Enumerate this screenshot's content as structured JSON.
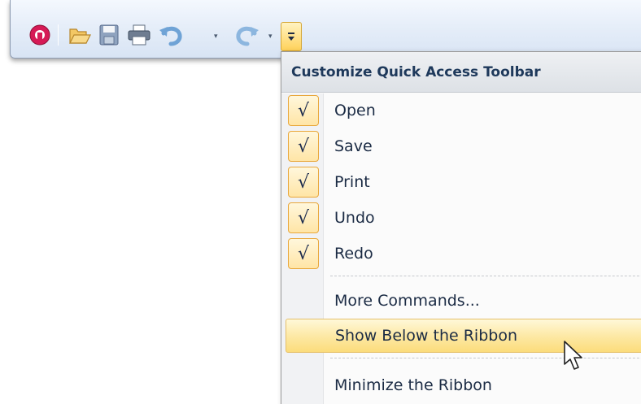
{
  "toolbar": {
    "app_icon": "app-logo-icon",
    "buttons": [
      {
        "name": "open-icon",
        "color": "#e0a82e"
      },
      {
        "name": "save-icon",
        "color": "#6d84a6"
      },
      {
        "name": "print-icon",
        "color": "#4d5d74"
      },
      {
        "name": "undo-icon",
        "color": "#6b9fd4"
      },
      {
        "name": "redo-icon",
        "color": "#6b9fd4"
      }
    ],
    "dropdown_arrow": "▾",
    "customize_glyph": "▼"
  },
  "menu": {
    "title": "Customize Quick Access Toolbar",
    "check_glyph": "√",
    "items": [
      {
        "label": "Open",
        "checked": true
      },
      {
        "label": "Save",
        "checked": true
      },
      {
        "label": "Print",
        "checked": true
      },
      {
        "label": "Undo",
        "checked": true
      },
      {
        "label": "Redo",
        "checked": true
      },
      {
        "label": "More Commands..."
      },
      {
        "label": "Show Below the Ribbon",
        "highlighted": true
      },
      {
        "label": "Minimize the Ribbon"
      }
    ]
  },
  "colors": {
    "header_text": "#1e395b",
    "check_border": "#e9a73a",
    "highlight": "#fde9a6"
  }
}
